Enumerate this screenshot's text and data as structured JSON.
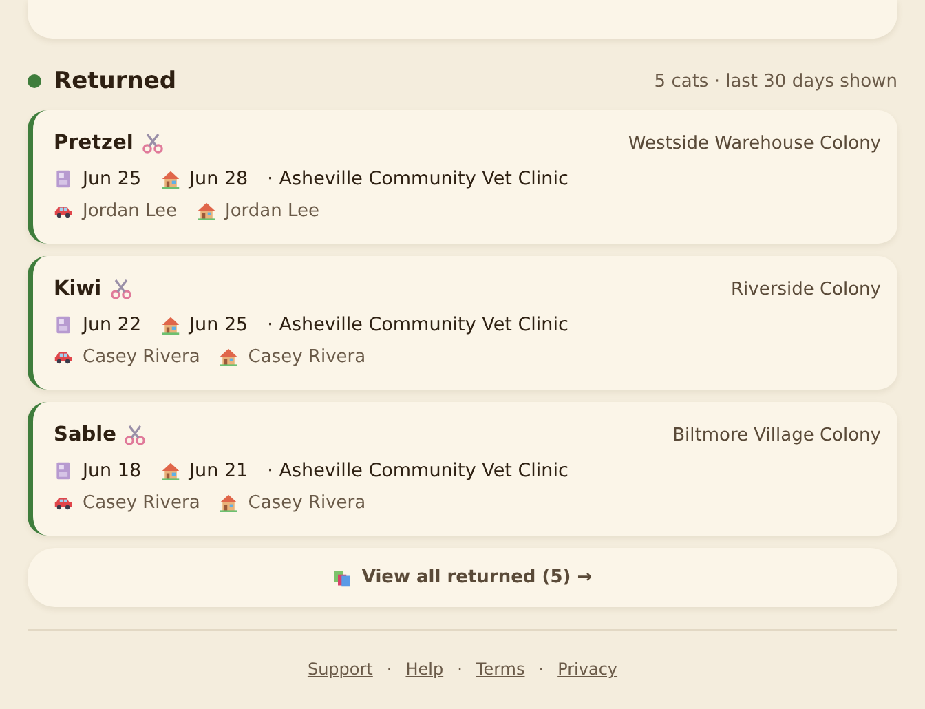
{
  "section": {
    "title": "Returned",
    "color": "#3f7d3c",
    "summary": "5 cats · last 30 days shown"
  },
  "cards": [
    {
      "name": "Pretzel",
      "neutered": true,
      "colony": "Westside Warehouse Colony",
      "intake_date": "Jun 25",
      "return_date": "Jun 28",
      "clinic": "· Asheville Community Vet Clinic",
      "transporter": "Jordan Lee",
      "returner": "Jordan Lee"
    },
    {
      "name": "Kiwi",
      "neutered": true,
      "colony": "Riverside Colony",
      "intake_date": "Jun 22",
      "return_date": "Jun 25",
      "clinic": "· Asheville Community Vet Clinic",
      "transporter": "Casey Rivera",
      "returner": "Casey Rivera"
    },
    {
      "name": "Sable",
      "neutered": true,
      "colony": "Biltmore Village Colony",
      "intake_date": "Jun 18",
      "return_date": "Jun 21",
      "clinic": "· Asheville Community Vet Clinic",
      "transporter": "Casey Rivera",
      "returner": "Casey Rivera"
    }
  ],
  "view_all": "View all returned (5) →",
  "footer": {
    "separator": "·",
    "links": [
      "Support",
      "Help",
      "Terms",
      "Privacy"
    ]
  }
}
